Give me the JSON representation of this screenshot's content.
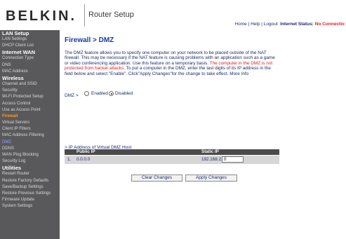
{
  "header": {
    "logo": "BELKIN.",
    "app_title": "Router Setup",
    "links": [
      "Home",
      "Help",
      "Logout"
    ],
    "status_label": "Internet Status:",
    "status_value": "No Connectio"
  },
  "sidebar": {
    "sections": [
      {
        "title": "LAN Setup",
        "items": [
          "LAN Settings",
          "DHCP Client List"
        ]
      },
      {
        "title": "Internet WAN",
        "items": [
          "Connection Type",
          "DNS",
          "MAC Address"
        ]
      },
      {
        "title": "Wireless",
        "items": [
          "Channel and SSID",
          "Security",
          "Wi-Fi Protected Setup",
          "Access Control",
          "Use as Access Point"
        ]
      },
      {
        "title": "Firewall",
        "items": [
          "Virtual Servers",
          "Client IP Filters",
          "MAC Address Filtering",
          "DMZ",
          "DDNS",
          "WAN Ping Blocking",
          "Security Log"
        ]
      },
      {
        "title": "Utilities",
        "items": [
          "Restart Router",
          "Restore Factory Defaults",
          "Save/Backup Settings",
          "Restore Previous Settings",
          "Firmware Update",
          "System Settings"
        ]
      }
    ],
    "current_item": "DMZ"
  },
  "main": {
    "title": "Firewall > DMZ",
    "description_1": "The DMZ feature allows you to specify one computer on your network to be placed outside of the NAT firewall. This may be necessary if the NAT feature is causing problems with an application such as a game or video conferencing application. Use this feature on a temporary basis. ",
    "description_warning": "The computer in the DMZ is not protected from hacker attacks.",
    "description_2": " To put a computer in the DMZ, enter the last digits of its IP address in the field below and select \"Enable\". Click\"Apply Changes\"for the change to take effect.",
    "more_info": "More Info",
    "dmz_label": "DMZ >",
    "enabled_label": "Enabled",
    "disabled_label": "Disabled",
    "dmz_state": "Disabled",
    "vhost_label": "> IP Address of Virtual DMZ Host",
    "table": {
      "headers": [
        "",
        "Public IP",
        "Static IP"
      ],
      "rows": [
        {
          "index": "1.",
          "public_ip": "0.0.0.0",
          "static_prefix": "192.168.2.",
          "static_last": "0"
        }
      ]
    },
    "clear_button": "Clear Changes",
    "apply_button": "Apply Changes"
  }
}
